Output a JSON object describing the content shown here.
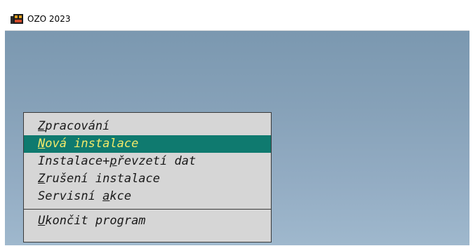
{
  "window": {
    "title": "OZO 2023",
    "icon": "app-movie-clapper-icon"
  },
  "colors": {
    "desktop": "#86a1b8",
    "menu_bg": "#d6d6d6",
    "selected_bg": "#0f7a6f",
    "selected_fg": "#f2e96a",
    "text": "#1a1a1a"
  },
  "menu": {
    "items": [
      {
        "hot": "Z",
        "rest": "pracování",
        "selected": false
      },
      {
        "hot": "N",
        "rest": "ová instalace",
        "selected": true
      },
      {
        "pre": "Instalace+",
        "hot": "p",
        "rest": "řevzetí dat",
        "selected": false
      },
      {
        "hot": "Z",
        "rest": "rušení instalace",
        "selected": false
      },
      {
        "pre": "Servisní ",
        "hot": "a",
        "rest": "kce",
        "selected": false
      }
    ],
    "exit": {
      "hot": "U",
      "rest": "končit program"
    }
  }
}
